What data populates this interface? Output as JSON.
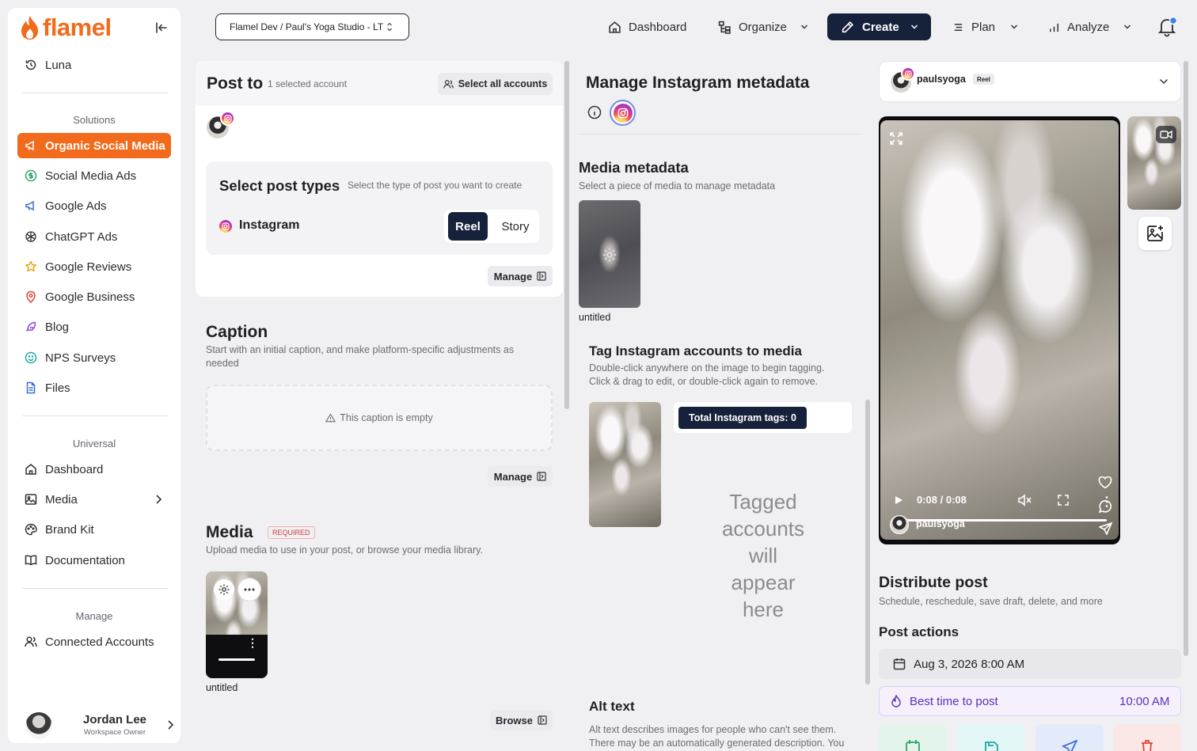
{
  "app": {
    "brand": "flamel"
  },
  "sidebar": {
    "top_item": "Luna",
    "solutions_title": "Solutions",
    "solutions": [
      {
        "label": "Organic Social Media",
        "icon": "megaphone-icon",
        "active": true
      },
      {
        "label": "Social Media Ads",
        "icon": "dollar-circle-icon"
      },
      {
        "label": "Google Ads",
        "icon": "megaphone-outline-icon"
      },
      {
        "label": "ChatGPT Ads",
        "icon": "openai-icon"
      },
      {
        "label": "Google Reviews",
        "icon": "star-icon"
      },
      {
        "label": "Google Business",
        "icon": "map-pin-icon"
      },
      {
        "label": "Blog",
        "icon": "feather-icon"
      },
      {
        "label": "NPS Surveys",
        "icon": "smile-icon"
      },
      {
        "label": "Files",
        "icon": "file-icon"
      }
    ],
    "universal_title": "Universal",
    "universal": [
      {
        "label": "Dashboard",
        "icon": "home-icon"
      },
      {
        "label": "Media",
        "icon": "image-icon"
      },
      {
        "label": "Brand Kit",
        "icon": "palette-icon"
      },
      {
        "label": "Documentation",
        "icon": "book-icon"
      }
    ],
    "manage_title": "Manage",
    "manage": [
      {
        "label": "Connected Accounts",
        "icon": "users-icon"
      }
    ],
    "user": {
      "name": "Jordan Lee",
      "role": "Workspace Owner"
    }
  },
  "topbar": {
    "workspace": "Flamel Dev / Paul's Yoga Studio - LT",
    "nav": {
      "dashboard": "Dashboard",
      "organize": "Organize",
      "create": "Create",
      "plan": "Plan",
      "analyze": "Analyze"
    }
  },
  "post_to": {
    "title": "Post to",
    "selected": "1 selected account",
    "select_all": "Select all accounts",
    "post_types_title": "Select post types",
    "post_types_sub": "Select the type of post you want to create",
    "platform": "Instagram",
    "types": [
      "Reel",
      "Story"
    ],
    "selected_type": "Reel",
    "manage": "Manage"
  },
  "caption": {
    "title": "Caption",
    "sub": "Start with an initial caption, and make platform-specific adjustments as needed",
    "empty": "This caption is empty",
    "manage": "Manage"
  },
  "media": {
    "title": "Media",
    "badge": "REQUIRED",
    "sub": "Upload media to use in your post, or browse your media library.",
    "file": "untitled",
    "browse": "Browse"
  },
  "metadata": {
    "title": "Manage Instagram metadata",
    "media_title": "Media metadata",
    "media_sub": "Select a piece of media to manage metadata",
    "file": "untitled",
    "tag_title": "Tag Instagram accounts to media",
    "tag_sub_1": "Double-click anywhere on the image to begin tagging.",
    "tag_sub_2": "Click & drag to edit, or double-click again to remove.",
    "tag_count": "Total Instagram tags: 0",
    "tag_placeholder_lines": [
      "Tagged",
      "accounts",
      "will",
      "appear",
      "here"
    ],
    "alt_title": "Alt text",
    "alt_sub_1": "Alt text describes images for people who can't see them.",
    "alt_sub_2": "There may be an automatically generated description. You"
  },
  "preview": {
    "account": "paulsyoga",
    "badge": "Reel",
    "time": "0:08 / 0:08",
    "overlay_account": "paulsyoga"
  },
  "distribute": {
    "title": "Distribute post",
    "sub": "Schedule, reschedule, save draft, delete, and more",
    "actions_title": "Post actions",
    "date": "Aug 3, 2026 8:00 AM",
    "best_time_label": "Best time to post",
    "best_time": "10:00 AM"
  },
  "colors": {
    "accent": "#f26a1b",
    "navy": "#16213b",
    "best_time_bg": "#f6f0fd",
    "best_time_fg": "#5b2fb8"
  }
}
